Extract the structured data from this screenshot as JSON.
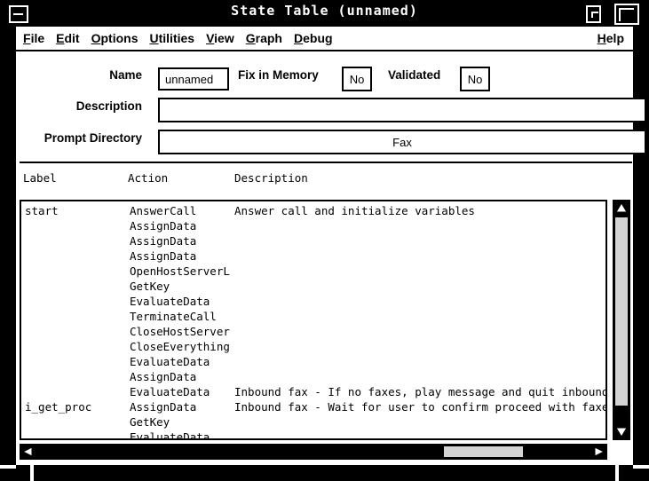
{
  "window": {
    "title": "State Table (unnamed)",
    "buttons": {
      "minimize": "—",
      "restore": "",
      "maximize": ""
    }
  },
  "menubar": {
    "items": [
      {
        "label": "File",
        "mnemonic": "F"
      },
      {
        "label": "Edit",
        "mnemonic": "E"
      },
      {
        "label": "Options",
        "mnemonic": "O"
      },
      {
        "label": "Utilities",
        "mnemonic": "U"
      },
      {
        "label": "View",
        "mnemonic": "V"
      },
      {
        "label": "Graph",
        "mnemonic": "G"
      },
      {
        "label": "Debug",
        "mnemonic": "D"
      }
    ],
    "help": {
      "label": "Help",
      "mnemonic": "H"
    }
  },
  "form": {
    "name": {
      "label": "Name",
      "value": "unnamed",
      "placeholder": ""
    },
    "fix_in_memory": {
      "label": "Fix in Memory",
      "value": "No"
    },
    "validated": {
      "label": "Validated",
      "value": "No"
    },
    "description": {
      "label": "Description",
      "value": "",
      "placeholder": ""
    },
    "prompt_directory": {
      "label": "Prompt Directory",
      "value": "Fax",
      "placeholder": ""
    }
  },
  "table": {
    "columns": [
      "Label",
      "Action",
      "Description"
    ],
    "rows": [
      {
        "label": "start",
        "action": "AnswerCall",
        "description": "Answer call and initialize variables"
      },
      {
        "label": "",
        "action": "AssignData",
        "description": ""
      },
      {
        "label": "",
        "action": "AssignData",
        "description": ""
      },
      {
        "label": "",
        "action": "AssignData",
        "description": ""
      },
      {
        "label": "",
        "action": "OpenHostServerL",
        "description": ""
      },
      {
        "label": "",
        "action": "GetKey",
        "description": ""
      },
      {
        "label": "",
        "action": "EvaluateData",
        "description": ""
      },
      {
        "label": "",
        "action": "TerminateCall",
        "description": ""
      },
      {
        "label": "",
        "action": "CloseHostServer",
        "description": ""
      },
      {
        "label": "",
        "action": "CloseEverything",
        "description": ""
      },
      {
        "label": "",
        "action": "EvaluateData",
        "description": ""
      },
      {
        "label": "",
        "action": "AssignData",
        "description": ""
      },
      {
        "label": "",
        "action": "EvaluateData",
        "description": "Inbound fax - If no faxes, play message and quit inbound"
      },
      {
        "label": "i_get_proc",
        "action": "AssignData",
        "description": "Inbound fax - Wait for user to confirm proceed with faxes"
      },
      {
        "label": "",
        "action": "GetKey",
        "description": ""
      },
      {
        "label": "",
        "action": "EvaluateData",
        "description": ""
      }
    ]
  },
  "scrollbars": {
    "vertical": {
      "up_icon": "triangle-up-icon",
      "down_icon": "triangle-down-icon",
      "thumb_position_percent": 13,
      "thumb_size_percent": 88
    },
    "horizontal": {
      "left_icon": "triangle-left-icon",
      "right_icon": "triangle-right-icon",
      "thumb_position_percent": 85,
      "thumb_size_percent": 14
    }
  },
  "colors": {
    "window_border": "#000000",
    "titlebar_bg": "#000000",
    "titlebar_fg": "#ffffff",
    "client_bg": "#ffffff",
    "text": "#000000",
    "scrollbar_thumb": "#d4d4d4",
    "scrollbar_trough": "#000000"
  }
}
